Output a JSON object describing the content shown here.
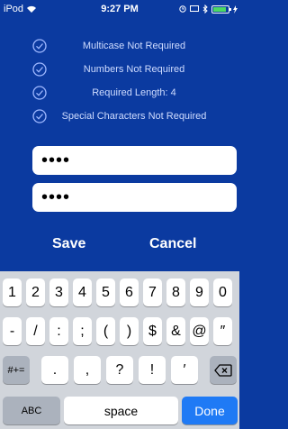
{
  "status_bar": {
    "carrier": "iPod",
    "time": "9:27 PM",
    "icons": [
      "wifi-icon",
      "clock-icon",
      "screen-icon",
      "bluetooth-icon",
      "battery-icon",
      "charging-icon"
    ]
  },
  "requirements": [
    {
      "label": "Multicase Not Required",
      "icon": "check-circle-icon"
    },
    {
      "label": "Numbers Not Required",
      "icon": "check-circle-icon"
    },
    {
      "label": "Required Length: 4",
      "icon": "check-circle-icon"
    },
    {
      "label": "Special Characters Not Required",
      "icon": "check-circle-icon"
    }
  ],
  "fields": {
    "password": {
      "value": "••••"
    },
    "confirm": {
      "value": "••••"
    }
  },
  "buttons": {
    "save": "Save",
    "cancel": "Cancel"
  },
  "keyboard": {
    "row1": [
      "1",
      "2",
      "3",
      "4",
      "5",
      "6",
      "7",
      "8",
      "9",
      "0"
    ],
    "row2": [
      "-",
      "/",
      ":",
      ";",
      "(",
      ")",
      "$",
      "&",
      "@",
      "″"
    ],
    "mode_key": "#+=",
    "row3": [
      ".",
      ",",
      "?",
      "!",
      "′"
    ],
    "abc_key": "ABC",
    "space_key": "space",
    "done_key": "Done"
  },
  "colors": {
    "background": "#0b3aa0",
    "keyboard": "#d1d5db",
    "done": "#1f7af5",
    "check": "#9fb8ff"
  }
}
